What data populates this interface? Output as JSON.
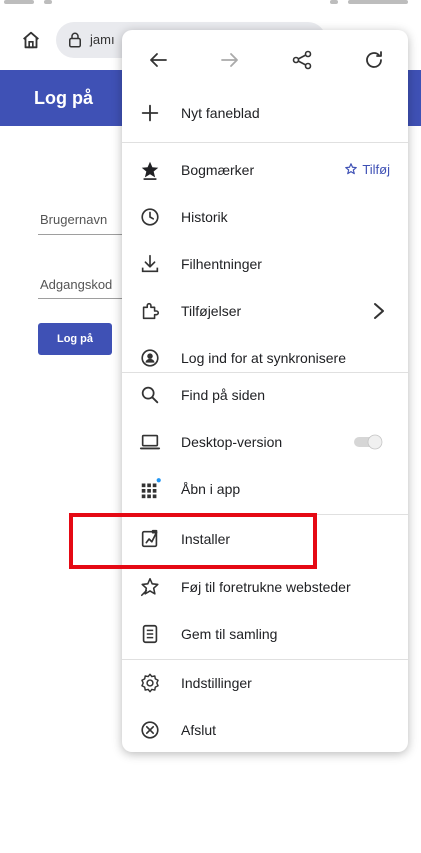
{
  "browser": {
    "url_text": "jamı"
  },
  "site": {
    "header_title": "Log på",
    "username_label": "Brugernavn",
    "password_label": "Adgangskod",
    "login_button": "Log på"
  },
  "menu": {
    "nav": [
      "back-icon",
      "forward-icon",
      "share-icon",
      "refresh-icon"
    ],
    "items": [
      {
        "label": "Nyt faneblad",
        "icon": "plus-icon"
      },
      {
        "label": "Bogmærker",
        "icon": "star-icon",
        "action": "Tilføj"
      },
      {
        "label": "Historik",
        "icon": "history-icon"
      },
      {
        "label": "Filhentninger",
        "icon": "download-icon"
      },
      {
        "label": "Tilføjelser",
        "icon": "extension-icon"
      },
      {
        "label": "Log ind for at synkronisere",
        "icon": "account-icon"
      },
      {
        "label": "Find på siden",
        "icon": "search-icon"
      },
      {
        "label": "Desktop-version",
        "icon": "desktop-icon",
        "toggle": false
      },
      {
        "label": "Åbn i app",
        "icon": "apps-grid-icon"
      },
      {
        "label": "Installer",
        "icon": "install-icon"
      },
      {
        "label": "Føj til foretrukne websteder",
        "icon": "pin-star-icon"
      },
      {
        "label": "Gem til samling",
        "icon": "collection-icon"
      },
      {
        "label": "Indstillinger",
        "icon": "settings-icon"
      },
      {
        "label": "Afslut",
        "icon": "exit-icon"
      }
    ]
  },
  "colors": {
    "brand": "#3f51b5",
    "highlight": "#e50914"
  }
}
